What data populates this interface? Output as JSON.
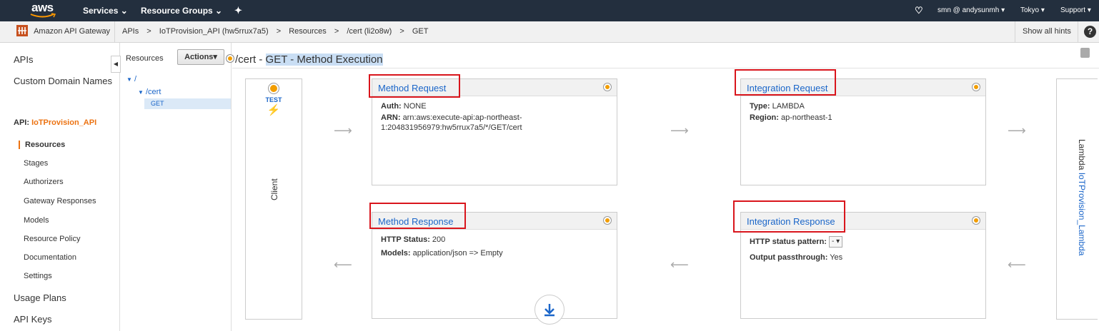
{
  "topbar": {
    "logo": "aws",
    "services": "Services",
    "resource_groups": "Resource Groups",
    "user": "smn @ andysunmh",
    "region": "Tokyo",
    "support": "Support"
  },
  "subbar": {
    "service": "Amazon API Gateway",
    "breadcrumb": [
      "APIs",
      "IoTProvision_API (hw5rrux7a5)",
      "Resources",
      "/cert (li2o8w)",
      "GET"
    ],
    "show_hints": "Show all hints"
  },
  "nav": {
    "apis": "APIs",
    "custom_domains": "Custom Domain Names",
    "api_prefix": "API:",
    "api_name": "IoTProvision_API",
    "items": [
      "Resources",
      "Stages",
      "Authorizers",
      "Gateway Responses",
      "Models",
      "Resource Policy",
      "Documentation",
      "Settings"
    ],
    "usage_plans": "Usage Plans",
    "api_keys": "API Keys"
  },
  "resources": {
    "label": "Resources",
    "actions": "Actions",
    "tree": [
      "/",
      "/cert",
      "GET"
    ]
  },
  "main": {
    "path": "/cert",
    "dash": " - ",
    "title": "GET - Method Execution",
    "test_label": "TEST",
    "client_label": "Client",
    "lambda_label": "Lambda",
    "lambda_name": "IoTProvision_Lambda",
    "method_request": {
      "title": "Method Request",
      "auth_label": "Auth:",
      "auth_value": "NONE",
      "arn_label": "ARN:",
      "arn_value_1": "arn:aws:execute-api:ap-northeast-",
      "arn_value_2": "1:204831956979:hw5rrux7a5/*/GET/cert"
    },
    "integration_request": {
      "title": "Integration Request",
      "type_label": "Type:",
      "type_value": "LAMBDA",
      "region_label": "Region:",
      "region_value": "ap-northeast-1"
    },
    "method_response": {
      "title": "Method Response",
      "status_label": "HTTP Status:",
      "status_value": "200",
      "models_label": "Models:",
      "models_value": "application/json => Empty"
    },
    "integration_response": {
      "title": "Integration Response",
      "pattern_label": "HTTP status pattern:",
      "pattern_value": "-",
      "passthrough_label": "Output passthrough:",
      "passthrough_value": "Yes"
    }
  },
  "colors": {
    "topbar": "#232f3e",
    "link": "#1b66c9",
    "accent": "#ec7211",
    "highlight_border": "#d9151c"
  }
}
